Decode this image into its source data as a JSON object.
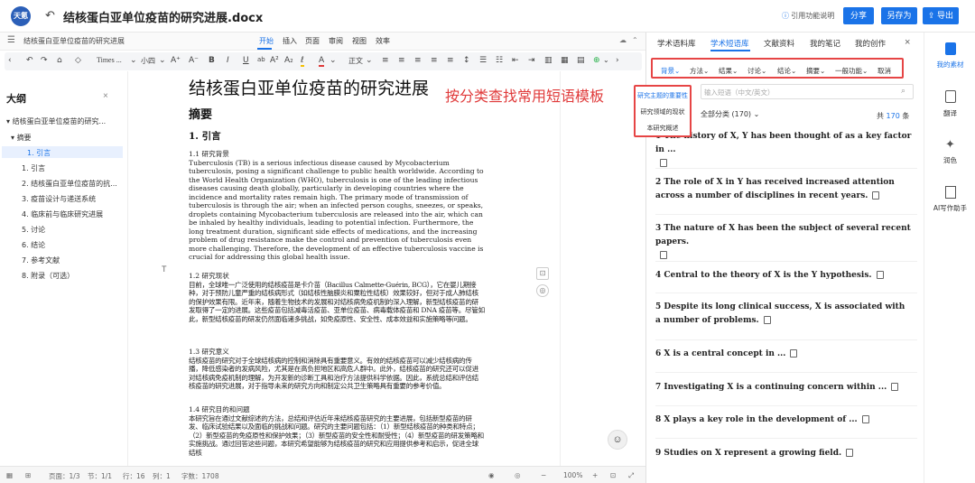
{
  "titlebar": {
    "doc_title": "结核蛋白亚单位疫苗的研究进展.docx",
    "ref_hint": "引用功能说明",
    "share": "分享",
    "save_as": "另存为",
    "export": "导出",
    "logo_text": "天氪"
  },
  "doc_header": {
    "doc_name": "结核蛋白亚单位疫苗的研究进展",
    "tabs": [
      "开始",
      "插入",
      "页面",
      "审阅",
      "视图",
      "效率"
    ]
  },
  "toolbar": {
    "font": "Times ...",
    "size": "小四",
    "style": "正文"
  },
  "outline": {
    "title": "大纲",
    "items": [
      "结核蛋白亚单位疫苗的研究...",
      "摘要",
      "1. 引言",
      "1. 引言",
      "2. 结核蛋白亚单位疫苗的抗...",
      "3. 疫苗设计与递送系统",
      "4. 临床前与临床研究进展",
      "5. 讨论",
      "6. 结论",
      "7. 参考文献",
      "8. 附录（可选）"
    ]
  },
  "document": {
    "title": "结核蛋白亚单位疫苗的研究进展",
    "abstract": "摘要",
    "intro": "1.  引言",
    "s11": "1.1 研究背景",
    "p1": "Tuberculosis (TB) is a serious infectious disease caused by Mycobacterium tuberculosis, posing a significant challenge to public health worldwide. According to the World Health Organization (WHO), tuberculosis is one of the leading infectious diseases causing death globally, particularly in developing countries where the incidence and mortality rates remain high. The primary mode of transmission of tuberculosis is through the air; when an infected person coughs, sneezes, or speaks, droplets containing Mycobacterium tuberculosis are released into the air, which can be inhaled by healthy individuals, leading to potential infection. Furthermore, the long treatment duration, significant side effects of medications, and the increasing problem of drug resistance make the control and prevention of tuberculosis even more challenging. Therefore, the development of an effective tuberculosis vaccine is crucial for addressing this global health issue.",
    "s12": "1.2 研究现状",
    "p2": "目前，全球唯一广泛使用的结核疫苗是卡介苗（Bacillus Calmette-Guérin, BCG），它在婴儿期接种，对于预防儿童严重的结核病形式（如结核性脑膜炎和粟粒性结核）效果较好，但对于成人肺结核的保护效果有限。近年来，随着生物技术的发展和对结核病免疫机制的深入理解，新型结核疫苗的研发取得了一定的进展。这些疫苗包括减毒活疫苗、亚单位疫苗、病毒载体疫苗和 DNA 疫苗等。尽管如此，新型结核疫苗的研发仍然面临诸多挑战，如免疫原性、安全性、成本效益和实施策略等问题。",
    "s13": "1.3 研究意义",
    "p3": "结核疫苗的研究对于全球结核病的控制和消除具有重要意义。有效的结核疫苗可以减少结核病的传播，降低感染者的发病风险，尤其是在高负担地区和高危人群中。此外，结核疫苗的研究还可以促进对结核病免疫机制的理解，为开发新的诊断工具和治疗方法提供科学依据。因此，系统总结和评估结核疫苗的研究进展，对于指导未来的研究方向和制定公共卫生策略具有重要的参考价值。",
    "s14": "1.4 研究目的和问题",
    "p4": "本研究旨在通过文献综述的方法，总结和评估近年来结核疫苗研究的主要进展，包括新型疫苗的研发、临床试验结果以及面临的挑战和问题。研究的主要问题包括：（1）新型结核疫苗的种类和特点；（2）新型疫苗的免疫原性和保护效果；（3）新型疫苗的安全性和耐受性；（4）新型疫苗的研发策略和实施挑战。通过回答这些问题，本研究希望能够为结核疫苗的研究和应用提供参考和启示，促进全球结核"
  },
  "annotation": "按分类查找常用短语模板",
  "statusbar": {
    "page": "页面：1/3",
    "section": "节：1/1",
    "row": "行：16",
    "col": "列：1",
    "words": "字数：1708",
    "zoom": "100%"
  },
  "panel": {
    "tabs": [
      "学术语料库",
      "学术短语库",
      "文献资料",
      "我的笔记",
      "我的创作"
    ],
    "categories": [
      "背景",
      "方法",
      "结果",
      "讨论",
      "结论",
      "摘要",
      "一般功能",
      "取消"
    ],
    "search_placeholder": "输入短语（中文/英文）",
    "dropdown": [
      "研究主题的重要性",
      "研究领域的现状",
      "本研究概述"
    ],
    "filter": "全部分类 (170)",
    "total_prefix": "共",
    "total_count": "170",
    "total_suffix": "条",
    "phrases": [
      "1  The history of X, Y has been thought of as a key factor in ...",
      "2  The role of X in Y has received increased attention across a number of disciplines in recent years.",
      "3  The nature of X has been the subject of several recent papers.",
      "4  Central to the theory of X is the Y hypothesis.",
      "5  Despite its long clinical success, X is associated with a number of problems.",
      "6  X is a central concept in ...",
      "7  Investigating X is a continuing concern within ...",
      "8  X plays a key role in the development of ...",
      "9  Studies on X represent a growing field."
    ]
  },
  "rightrail": {
    "items": [
      "我的素材",
      "翻译",
      "润色",
      "AI写作助手"
    ]
  }
}
